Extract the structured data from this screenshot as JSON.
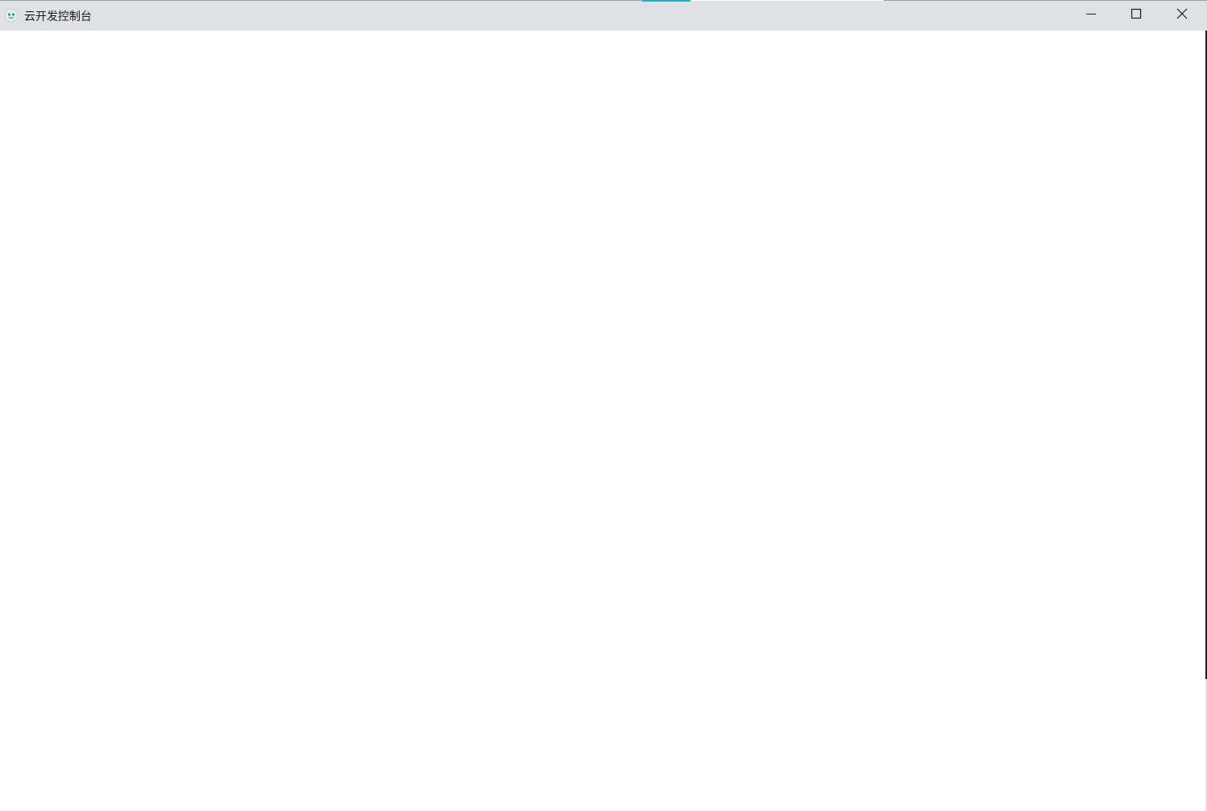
{
  "window": {
    "title": "云开发控制台",
    "app_icon": "cloudbase-icon",
    "controls": {
      "minimize": "minimize-icon",
      "maximize": "maximize-icon",
      "close": "close-icon"
    }
  },
  "colors": {
    "titlebar_bg": "#dee1e6",
    "content_bg": "#ffffff",
    "accent": "#17b5c4"
  }
}
